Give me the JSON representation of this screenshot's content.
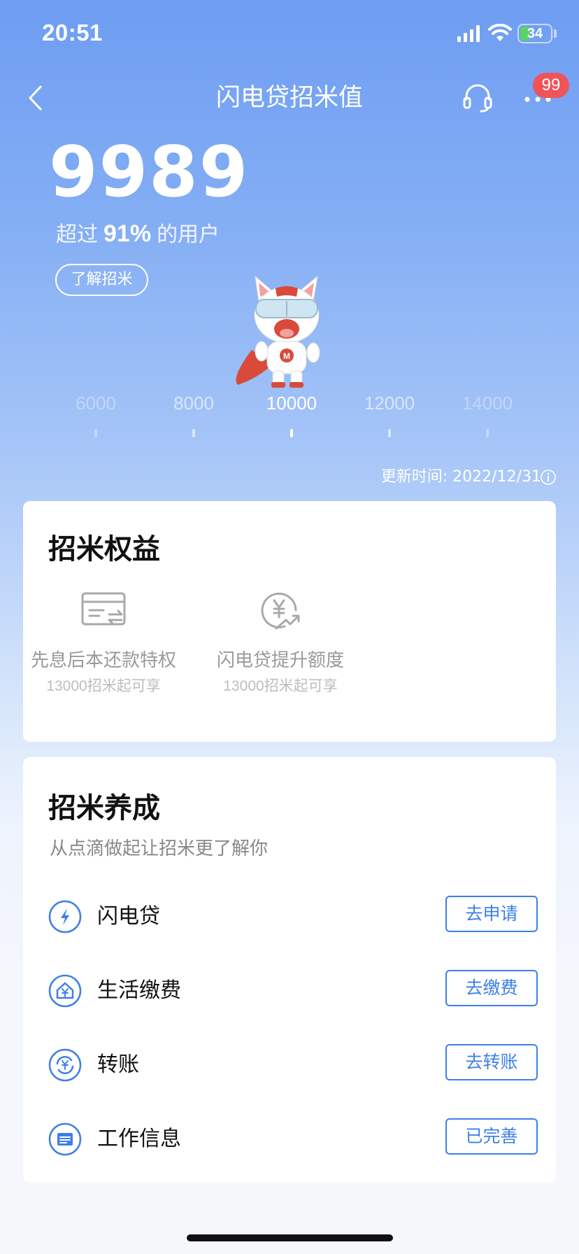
{
  "status_bar": {
    "time": "20:51",
    "battery": "34",
    "battery_level_percent": 34,
    "charging": true
  },
  "nav": {
    "title": "闪电贷招米值",
    "badge_count": "99"
  },
  "score": {
    "value": "9989",
    "percentile_prefix": "超过",
    "percentile_value": "91%",
    "percentile_suffix": "的用户",
    "learn_button": "了解招米"
  },
  "scale": {
    "ticks": [
      "6000",
      "8000",
      "10000",
      "12000",
      "14000"
    ],
    "current_index": 2
  },
  "update_time": "更新时间: 2022/12/31",
  "benefits": {
    "title": "招米权益",
    "items": [
      {
        "icon": "card-transfer-icon",
        "name": "先息后本还款特权",
        "sub": "13000招米起可享"
      },
      {
        "icon": "yuan-increase-icon",
        "name": "闪电贷提升额度",
        "sub": "13000招米起可享"
      }
    ]
  },
  "growth": {
    "title": "招米养成",
    "subtitle": "从点滴做起让招米更了解你",
    "tasks": [
      {
        "icon": "lightning-icon",
        "name": "闪电贷",
        "button": "去申请"
      },
      {
        "icon": "house-yuan-icon",
        "name": "生活缴费",
        "button": "去缴费"
      },
      {
        "icon": "transfer-yuan-icon",
        "name": "转账",
        "button": "去转账"
      },
      {
        "icon": "id-card-icon",
        "name": "工作信息",
        "button": "已完善"
      }
    ]
  },
  "colors": {
    "accent": "#3E7FE8",
    "badge": "#F0535A",
    "battery": "#5DD16A"
  }
}
